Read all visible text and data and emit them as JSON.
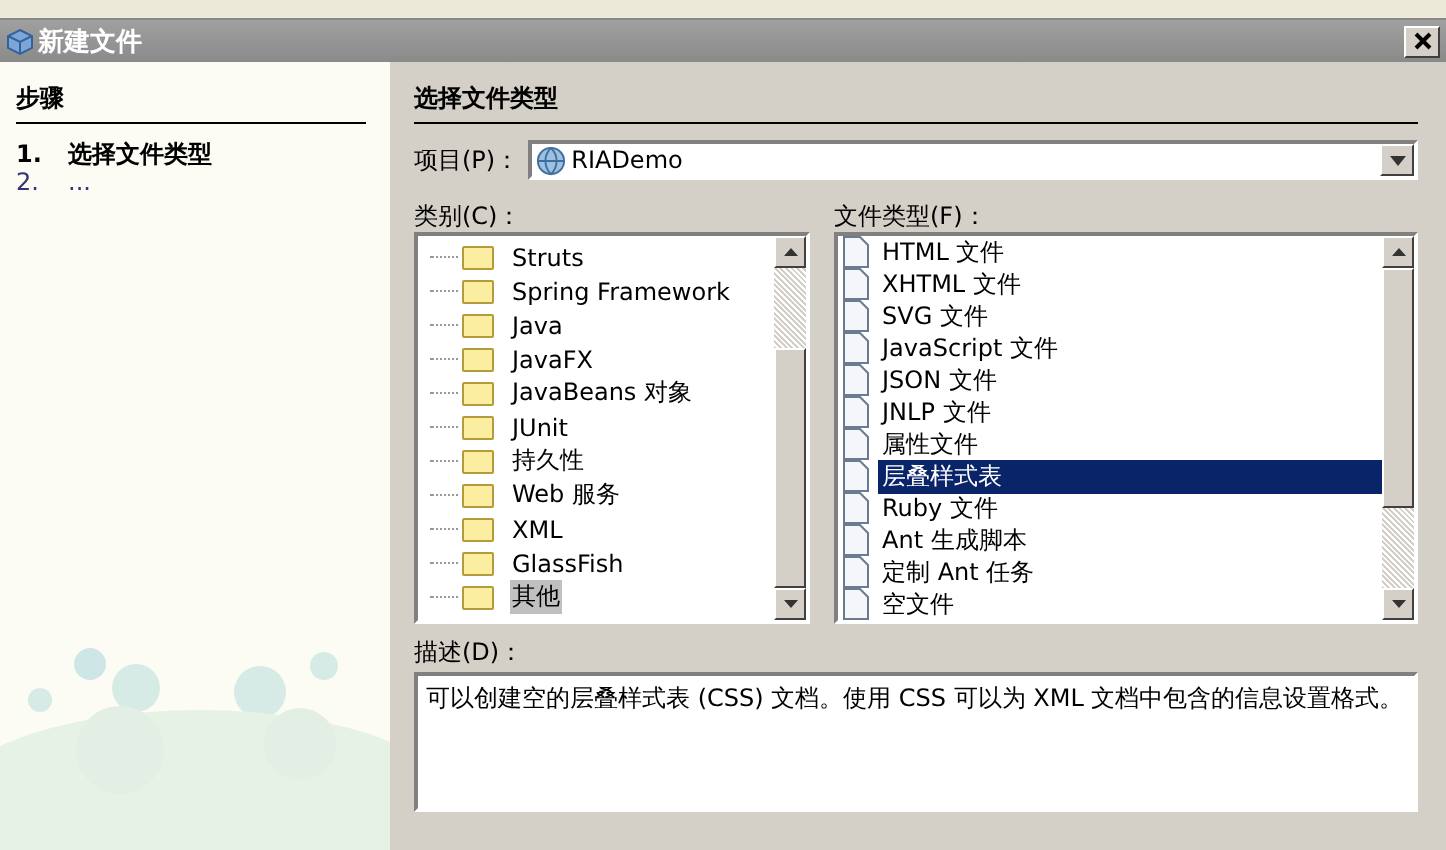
{
  "window": {
    "title": "新建文件"
  },
  "steps": {
    "title": "步骤",
    "items": [
      {
        "number": "1.",
        "label": "选择文件类型",
        "selected": true
      },
      {
        "number": "2.",
        "label": "...",
        "selected": false
      }
    ]
  },
  "panel_title": "选择文件类型",
  "project": {
    "label": "项目(P)：",
    "value": "RIADemo"
  },
  "categories": {
    "label": "类别(C)：",
    "items": [
      {
        "label": "Struts",
        "selected": false
      },
      {
        "label": "Spring Framework",
        "selected": false
      },
      {
        "label": "Java",
        "selected": false
      },
      {
        "label": "JavaFX",
        "selected": false
      },
      {
        "label": "JavaBeans 对象",
        "selected": false
      },
      {
        "label": "JUnit",
        "selected": false
      },
      {
        "label": "持久性",
        "selected": false
      },
      {
        "label": "Web 服务",
        "selected": false
      },
      {
        "label": "XML",
        "selected": false
      },
      {
        "label": "GlassFish",
        "selected": false
      },
      {
        "label": "其他",
        "selected": true
      }
    ]
  },
  "file_types": {
    "label": "文件类型(F)：",
    "items": [
      {
        "label": "HTML 文件",
        "selected": false
      },
      {
        "label": "XHTML 文件",
        "selected": false
      },
      {
        "label": "SVG 文件",
        "selected": false
      },
      {
        "label": "JavaScript 文件",
        "selected": false
      },
      {
        "label": "JSON 文件",
        "selected": false
      },
      {
        "label": "JNLP 文件",
        "selected": false
      },
      {
        "label": "属性文件",
        "selected": false
      },
      {
        "label": "层叠样式表",
        "selected": true
      },
      {
        "label": "Ruby 文件",
        "selected": false
      },
      {
        "label": "Ant 生成脚本",
        "selected": false
      },
      {
        "label": "定制 Ant 任务",
        "selected": false
      },
      {
        "label": "空文件",
        "selected": false
      }
    ]
  },
  "description": {
    "label": "描述(D)：",
    "text": "可以创建空的层叠样式表 (CSS) 文档。使用 CSS 可以为 XML 文档中包含的信息设置格式。"
  }
}
